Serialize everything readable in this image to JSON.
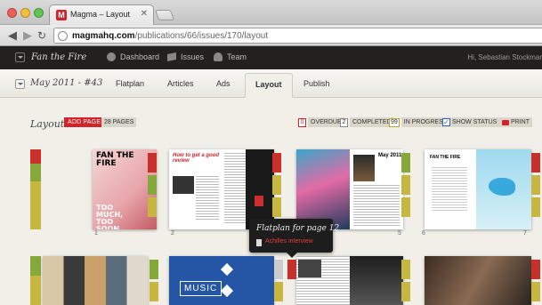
{
  "browser": {
    "tab_title": "Magma – Layout",
    "tab_favicon": "M",
    "tab_close": "✕",
    "url_host": "magmahq.com",
    "url_path": "/publications/66/issues/170/layout",
    "icons": {
      "back": "◀",
      "forward": "▶",
      "reload": "↻"
    }
  },
  "app_header": {
    "publication": "Fan the Fire",
    "nav": [
      {
        "label": "Dashboard",
        "icon": "dashboard-icon"
      },
      {
        "label": "Issues",
        "icon": "issues-icon"
      },
      {
        "label": "Team",
        "icon": "team-icon"
      }
    ],
    "greeting": "Hi, Sebastian Stockmar"
  },
  "sub_header": {
    "issue": "May 2011 - #43",
    "tabs": [
      {
        "label": "Flatplan",
        "active": false
      },
      {
        "label": "Articles",
        "active": false
      },
      {
        "label": "Ads",
        "active": false
      },
      {
        "label": "Layout",
        "active": true
      },
      {
        "label": "Publish",
        "active": false
      }
    ]
  },
  "layout_bar": {
    "title": "Layout",
    "add_pages": "ADD PAGES",
    "pages_count": "28 PAGES",
    "filters": [
      {
        "count": "0",
        "label": "OVERDUE"
      },
      {
        "count": "2",
        "label": "COMPLETED"
      },
      {
        "count": "99",
        "label": "IN PROGRESS"
      }
    ],
    "show_status": "SHOW STATUS",
    "show_status_checked": "✓",
    "print": "PRINT"
  },
  "spreads": {
    "row1_page_numbers": [
      "1",
      "2",
      "3",
      "4",
      "5",
      "6",
      "7"
    ],
    "cover_title": "FAN THE FIRE",
    "cover_tagline": "TOO MUCH, TOO SOON",
    "page2_headline": "How to get a good review",
    "page4_title": "May 2011",
    "music_label": "MUSIC"
  },
  "tooltip": {
    "title": "Flatplan for page 12",
    "item": "Achilles interview"
  },
  "colors": {
    "brand_red": "#d2232a",
    "status_red": "#c9302c",
    "status_green": "#86a83a",
    "status_yellow": "#c7b640",
    "header_dark": "#222120"
  }
}
